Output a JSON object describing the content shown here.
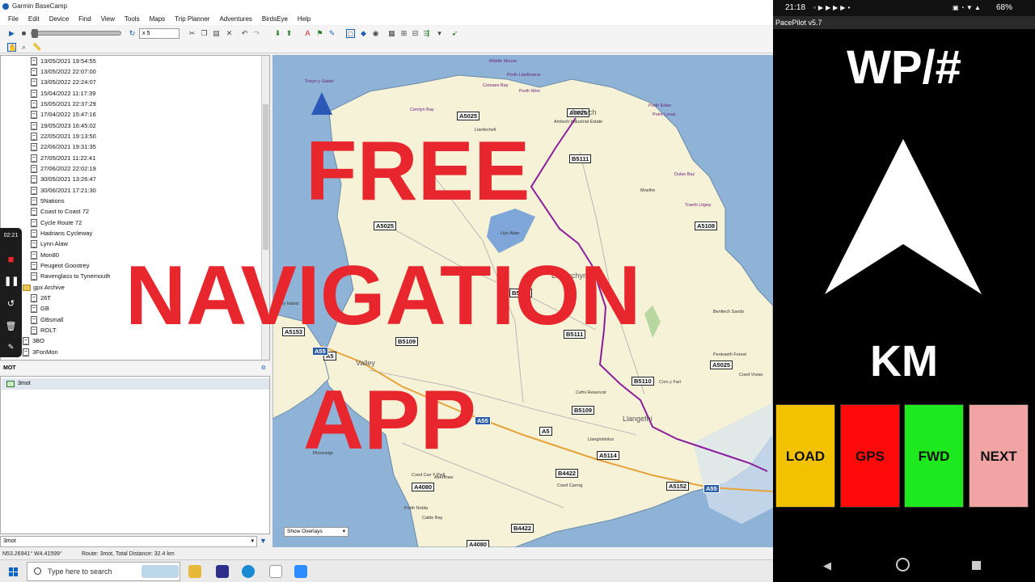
{
  "window": {
    "title": "Garmin BaseCamp",
    "menus": [
      "File",
      "Edit",
      "Device",
      "Find",
      "View",
      "Tools",
      "Maps",
      "Trip Planner",
      "Adventures",
      "BirdsEye",
      "Help"
    ],
    "speed_value": "x 5"
  },
  "tree": {
    "items": [
      "13/05/2021 19:54:55",
      "13/05/2022 22:07:00",
      "13/05/2022 22:24:07",
      "15/04/2022 11:17:39",
      "15/05/2021 22:37:29",
      "17/04/2022 15:47:16",
      "19/05/2023 16:45:02",
      "22/05/2021 19:13:50",
      "22/06/2021 19:31:35",
      "27/05/2021 11:22:41",
      "27/06/2022 22:02:19",
      "30/05/2021 13:26:47",
      "30/06/2021 17:21:30",
      "5Nations",
      "Coast to Coast 72",
      "Cycle Route 72",
      "Hadrians Cycleway",
      "Lynn Alaw",
      "Mon80",
      "Peugeot Goostrey",
      "Ravenglass to Tynemouth"
    ],
    "folder": "gpx Archive",
    "sub_items": [
      "26T",
      "GB",
      "GBsmall",
      "ROLT"
    ],
    "root_items": [
      "3BO",
      "3FonMon"
    ]
  },
  "mot": {
    "header": "MOT",
    "route": "3mot",
    "selected": "3mot"
  },
  "status": {
    "coords": "N53.26941° W4.41599°",
    "route_info": "Route: 3mot, Total Distance: 32.4 km"
  },
  "map": {
    "overlay_select": "Show Overlays",
    "shields": [
      "A5025",
      "A5025",
      "B5111",
      "A5025",
      "A5108",
      "B5112",
      "B5111",
      "A5153",
      "A5",
      "B5109",
      "B5110",
      "A5025",
      "B5109",
      "A5",
      "A5114",
      "B4422",
      "A4080",
      "A5152",
      "B4422",
      "A4080"
    ],
    "blue_shields": [
      "A55",
      "A55",
      "A55"
    ],
    "labels": [
      "Middle Mouse",
      "Trwyn y Gader",
      "Porth Llanlleiana",
      "Cemaes Bay",
      "Porth Wen",
      "Cemlyn Bay",
      "Amlwch",
      "Porth Eilian",
      "Point Lynas",
      "Amlwch Industrial Estate",
      "Llanfechell",
      "Llyn Alaw",
      "Dulas Bay",
      "Moelfre",
      "Traeth Lligwy",
      "Llanerchymedd",
      "Benllech Sands",
      "Pentraeth Forest",
      "Coed Vivian",
      "Valley",
      "Holy Island",
      "Llangefni",
      "Cors y Farl",
      "Cefni Reservoir",
      "Aberffraw",
      "Coed Cwr Y Pwll",
      "Coed Carrog",
      "Porth Nobla",
      "Cable Bay",
      "Rhosneigr",
      "Llangristiolus"
    ]
  },
  "overlay": {
    "line1": "FREE",
    "line2": "NAVIGATION",
    "line3": "APP"
  },
  "recorder": {
    "time": "02:21"
  },
  "taskbar": {
    "search_placeholder": "Type here to search"
  },
  "phone": {
    "time": "21:18",
    "battery": "68%",
    "app_title": "PacePilot  v5.7",
    "waypoint_label": "WP/#",
    "distance_label": "KM",
    "buttons": [
      {
        "label": "LOAD",
        "color": "#f2c200"
      },
      {
        "label": "GPS",
        "color": "#ff0a0a"
      },
      {
        "label": "FWD",
        "color": "#1ee81e"
      },
      {
        "label": "NEXT",
        "color": "#f0a4a4"
      }
    ]
  },
  "colors": {
    "overlay_red": "#e8262d",
    "route_purple": "#8a1e9a",
    "land": "#f6f2d8",
    "sea": "#8fb3d6"
  }
}
